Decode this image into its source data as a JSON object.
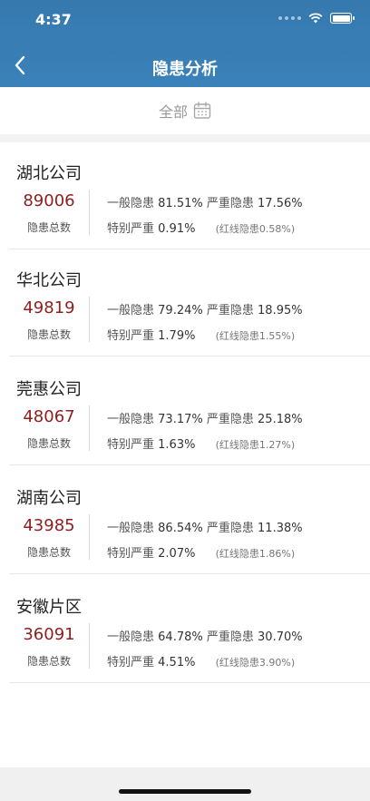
{
  "status": {
    "time": "4:37"
  },
  "nav": {
    "title": "隐患分析"
  },
  "filter": {
    "label": "全部"
  },
  "companies": [
    {
      "name": "湖北公司",
      "total": "89006",
      "total_label": "隐患总数",
      "general_label": "一般隐患",
      "general": "81.51%",
      "serious_label": "严重隐患",
      "serious": "17.56%",
      "critical_label": "特别严重",
      "critical": "0.91%",
      "redline": "(红线隐患0.58%)"
    },
    {
      "name": "华北公司",
      "total": "49819",
      "total_label": "隐患总数",
      "general_label": "一般隐患",
      "general": "79.24%",
      "serious_label": "严重隐患",
      "serious": "18.95%",
      "critical_label": "特别严重",
      "critical": "1.79%",
      "redline": "(红线隐患1.55%)"
    },
    {
      "name": "莞惠公司",
      "total": "48067",
      "total_label": "隐患总数",
      "general_label": "一般隐患",
      "general": "73.17%",
      "serious_label": "严重隐患",
      "serious": "25.18%",
      "critical_label": "特别严重",
      "critical": "1.63%",
      "redline": "(红线隐患1.27%)"
    },
    {
      "name": "湖南公司",
      "total": "43985",
      "total_label": "隐患总数",
      "general_label": "一般隐患",
      "general": "86.54%",
      "serious_label": "严重隐患",
      "serious": "11.38%",
      "critical_label": "特别严重",
      "critical": "2.07%",
      "redline": "(红线隐患1.86%)"
    },
    {
      "name": "安徽片区",
      "total": "36091",
      "total_label": "隐患总数",
      "general_label": "一般隐患",
      "general": "64.78%",
      "serious_label": "严重隐患",
      "serious": "30.70%",
      "critical_label": "特别严重",
      "critical": "4.51%",
      "redline": "(红线隐患3.90%)"
    }
  ],
  "icons": {
    "back": "chevron-left-icon",
    "calendar": "calendar-icon",
    "wifi": "wifi-icon",
    "battery": "battery-icon",
    "signal": "signal-icon"
  },
  "colors": {
    "header": "#3579ae",
    "total_number": "#8f1d1d",
    "filter_text": "#9a9a9a"
  }
}
